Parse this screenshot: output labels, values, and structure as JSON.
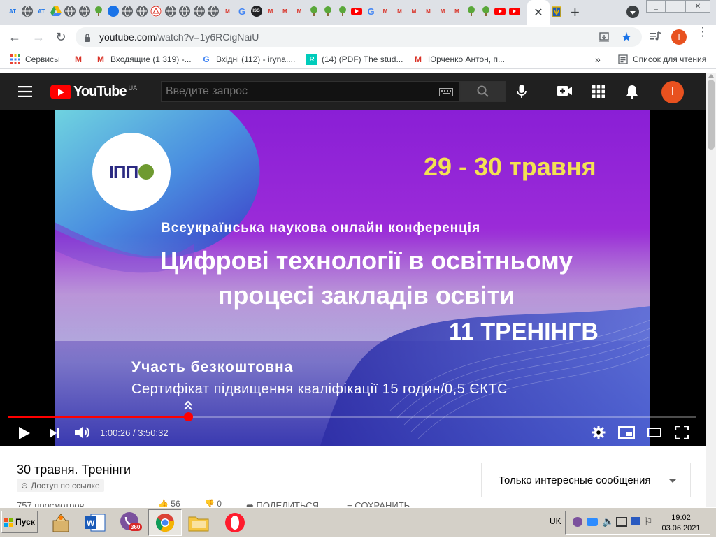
{
  "browser": {
    "active_tab_close": "✕",
    "new_tab": "+",
    "url_host": "youtube.com",
    "url_path": "/watch?v=1y6RCigNaiU",
    "profile_initial": "I",
    "tab_favicons": [
      {
        "kind": "at",
        "text": "AT"
      },
      {
        "kind": "globe",
        "text": ""
      },
      {
        "kind": "at",
        "text": "AT"
      },
      {
        "kind": "gdrive",
        "text": ""
      },
      {
        "kind": "globe",
        "text": ""
      },
      {
        "kind": "globe",
        "text": ""
      },
      {
        "kind": "tree",
        "text": ""
      },
      {
        "kind": "blue",
        "text": ""
      },
      {
        "kind": "globe",
        "text": ""
      },
      {
        "kind": "globe",
        "text": ""
      },
      {
        "kind": "red",
        "text": ""
      },
      {
        "kind": "globe",
        "text": ""
      },
      {
        "kind": "globe",
        "text": ""
      },
      {
        "kind": "globe",
        "text": ""
      },
      {
        "kind": "globe",
        "text": ""
      },
      {
        "kind": "gmail",
        "text": "M"
      },
      {
        "kind": "g",
        "text": "G"
      },
      {
        "kind": "isg",
        "text": "ISG"
      },
      {
        "kind": "gmail",
        "text": "M"
      },
      {
        "kind": "gmail",
        "text": "M"
      },
      {
        "kind": "gmail",
        "text": "M"
      },
      {
        "kind": "tree",
        "text": ""
      },
      {
        "kind": "tree",
        "text": ""
      },
      {
        "kind": "tree",
        "text": ""
      },
      {
        "kind": "yt",
        "text": ""
      },
      {
        "kind": "g",
        "text": "G"
      },
      {
        "kind": "gmail",
        "text": "M"
      },
      {
        "kind": "gmail",
        "text": "M"
      },
      {
        "kind": "gmail",
        "text": "M"
      },
      {
        "kind": "gmail",
        "text": "M"
      },
      {
        "kind": "gmail",
        "text": "M"
      },
      {
        "kind": "gmail",
        "text": "M"
      },
      {
        "kind": "tree",
        "text": ""
      },
      {
        "kind": "tree",
        "text": ""
      },
      {
        "kind": "yt",
        "text": ""
      },
      {
        "kind": "yt",
        "text": ""
      }
    ]
  },
  "bookmarks": [
    {
      "icon": "apps-icon",
      "label": "Сервисы"
    },
    {
      "icon": "gmail-icon",
      "label": ""
    },
    {
      "icon": "gmail-icon",
      "label": "Входящие (1 319) -..."
    },
    {
      "icon": "google-icon",
      "label": "Вхідні (112) - iryna...."
    },
    {
      "icon": "researchgate-icon",
      "label": "(14) (PDF) The stud..."
    },
    {
      "icon": "gmail-icon",
      "label": "Юрченко Антон, п..."
    }
  ],
  "reading_list": "Список для чтения",
  "youtube": {
    "logo_text": "YouTube",
    "region": "UA",
    "search_placeholder": "Введите запрос",
    "avatar_initial": "I"
  },
  "video": {
    "logo": "ІПП",
    "dates": "29 - 30 травня",
    "subtitle": "Всеукраїнська наукова онлайн конференція",
    "title_line1": "Цифрові технології в освітньому",
    "title_line2": "процесі закладів освіти",
    "trainings": "11 ТРЕНІНГВ",
    "free": "Участь безкоштовна",
    "cert": "Сертифікат підвищення кваліфікації 15 годин/0,5 ЄКТС",
    "progress": 0.2614,
    "time": "1:00:26 / 3:50:32"
  },
  "page": {
    "title": "30 травня. Тренінги",
    "access": "Доступ по ссылке",
    "views": "757 просмотров",
    "likes": "56",
    "dislikes": "0",
    "share": "ПОДЕЛИТЬСЯ",
    "save": "СОХРАНИТЬ",
    "chat_filter": "Только интересные сообщения"
  },
  "taskbar": {
    "start": "Пуск",
    "lang": "UK",
    "time": "19:02",
    "date": "03.06.2021",
    "viber_badge": "360"
  }
}
